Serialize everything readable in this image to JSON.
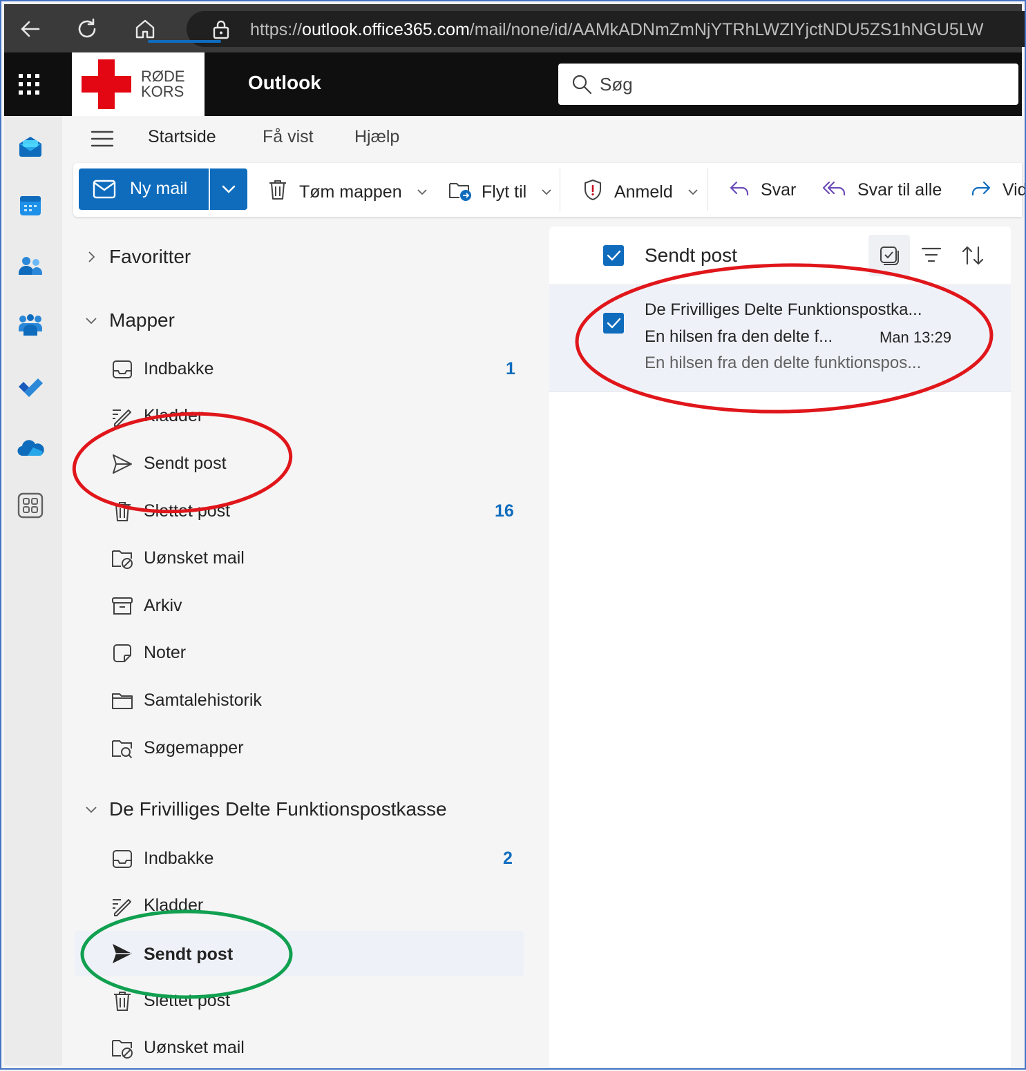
{
  "browser": {
    "url_prefix": "https://",
    "url_host": "outlook.office365.com",
    "url_path": "/mail/none/id/AAMkADNmZmNjYTRhLWZlYjctNDU5ZS1hNGU5LW"
  },
  "header": {
    "logo_line1": "RØDE",
    "logo_line2": "KORS",
    "app_title": "Outlook",
    "search_placeholder": "Søg"
  },
  "tabs": [
    {
      "label": "Startside",
      "active": true
    },
    {
      "label": "Få vist"
    },
    {
      "label": "Hjælp"
    }
  ],
  "ribbon": {
    "new_mail": "Ny mail",
    "empty_folder": "Tøm mappen",
    "move_to": "Flyt til",
    "report": "Anmeld",
    "reply": "Svar",
    "reply_all": "Svar til alle",
    "forward": "Vid"
  },
  "folders": {
    "favorites": "Favoritter",
    "mailbox1": {
      "name": "Mapper",
      "items": [
        {
          "label": "Indbakke",
          "count": "1"
        },
        {
          "label": "Kladder"
        },
        {
          "label": "Sendt post"
        },
        {
          "label": "Slettet post",
          "count": "16"
        },
        {
          "label": "Uønsket mail"
        },
        {
          "label": "Arkiv"
        },
        {
          "label": "Noter"
        },
        {
          "label": "Samtalehistorik"
        },
        {
          "label": "Søgemapper"
        }
      ]
    },
    "mailbox2": {
      "name": "De Frivilliges Delte Funktionspostkasse",
      "items": [
        {
          "label": "Indbakke",
          "count": "2"
        },
        {
          "label": "Kladder"
        },
        {
          "label": "Sendt post",
          "selected": true
        },
        {
          "label": "Slettet post"
        },
        {
          "label": "Uønsket mail"
        }
      ]
    }
  },
  "message_list": {
    "title": "Sendt post",
    "messages": [
      {
        "sender": "De Frivilliges Delte Funktionspostka...",
        "subject": "En hilsen fra den delte f...",
        "time": "Man 13:29",
        "preview": "En hilsen fra den delte funktionspos..."
      }
    ]
  },
  "colors": {
    "accent": "#0f6cbd",
    "annotation_red": "#e0161b",
    "annotation_green": "#10a050"
  }
}
